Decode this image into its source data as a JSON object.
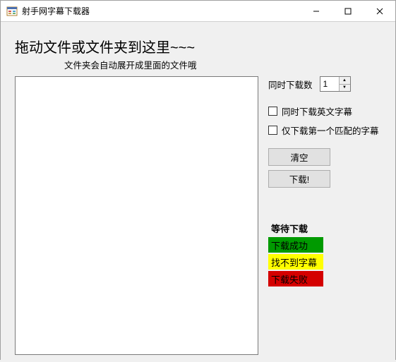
{
  "window": {
    "title": "射手网字幕下载器"
  },
  "headings": {
    "main": "拖动文件或文件夹到这里~~~",
    "sub": "文件夹会自动展开成里面的文件哦"
  },
  "side": {
    "concurrent_label": "同时下载数",
    "concurrent_value": "1",
    "checkbox_en": "同时下载英文字幕",
    "checkbox_first": "仅下载第一个匹配的字幕",
    "btn_clear": "清空",
    "btn_download": "下载!"
  },
  "legend": {
    "waiting": "等待下载",
    "success": "下载成功",
    "notfound": "找不到字幕",
    "failed": "下载失败"
  }
}
